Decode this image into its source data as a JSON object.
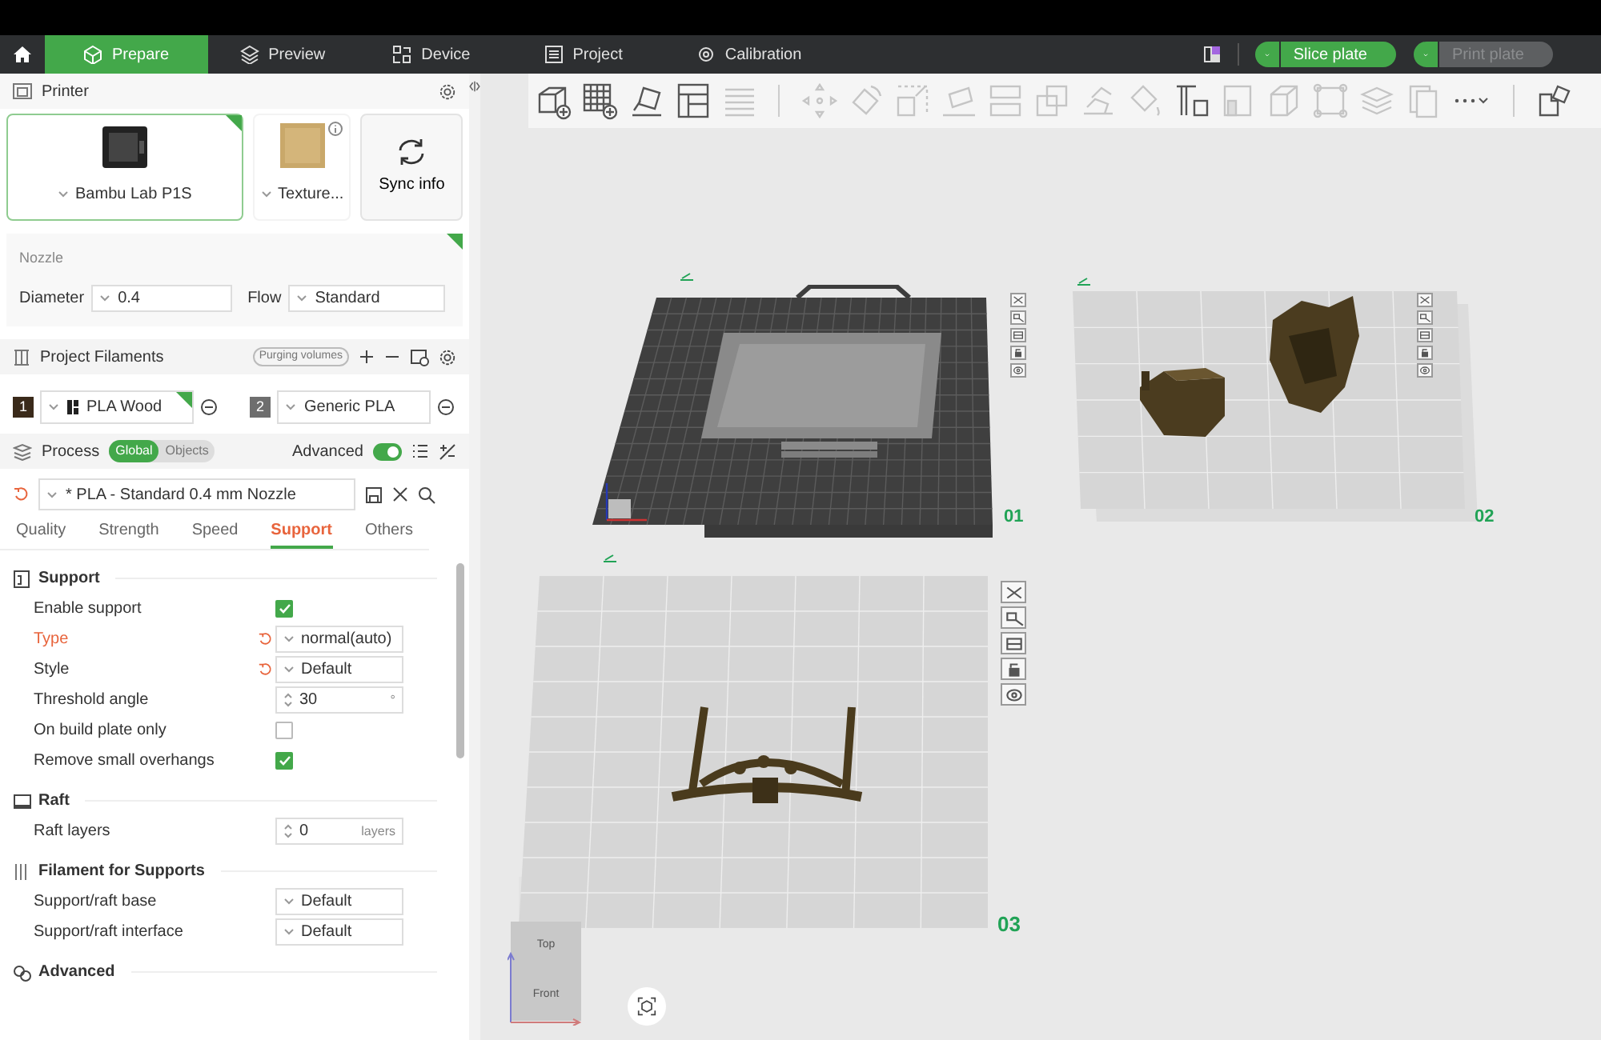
{
  "nav": {
    "tabs": [
      {
        "label": "Prepare",
        "selected": true
      },
      {
        "label": "Preview",
        "selected": false
      },
      {
        "label": "Device",
        "selected": false
      },
      {
        "label": "Project",
        "selected": false
      },
      {
        "label": "Calibration",
        "selected": false
      }
    ],
    "slice_button": {
      "label": "Slice plate",
      "disabled": false
    },
    "print_button": {
      "label": "Print plate",
      "disabled": true
    }
  },
  "printer": {
    "title": "Printer",
    "name": "Bambu Lab P1S",
    "synced": true,
    "plate_type": "Texture...",
    "sync_label": "Sync info",
    "nozzle": {
      "title": "Nozzle",
      "synced": true,
      "diameter_label": "Diameter",
      "diameter": "0.4",
      "flow_label": "Flow",
      "flow": "Standard"
    }
  },
  "filaments": {
    "title": "Project Filaments",
    "purging": "Purging volumes",
    "items": [
      {
        "index": "1",
        "name": "PLA Wood",
        "color": "#3a2a1a",
        "synced": true
      },
      {
        "index": "2",
        "name": "Generic PLA",
        "color": "#6e6e6e",
        "synced": false
      }
    ]
  },
  "process": {
    "title": "Process",
    "modes": [
      {
        "label": "Global",
        "selected": true
      },
      {
        "label": "Objects",
        "selected": false
      }
    ],
    "advanced_label": "Advanced",
    "advanced": true,
    "preset": "* PLA - Standard 0.4 mm Nozzle",
    "tabs": [
      {
        "label": "Quality",
        "selected": false
      },
      {
        "label": "Strength",
        "selected": false
      },
      {
        "label": "Speed",
        "selected": false
      },
      {
        "label": "Support",
        "selected": true
      },
      {
        "label": "Others",
        "selected": false
      }
    ],
    "groups": [
      {
        "title": "Support",
        "rows": [
          {
            "kind": "checkbox",
            "label": "Enable support",
            "checked": true
          },
          {
            "kind": "select",
            "label": "Type",
            "value": "normal(auto)",
            "modified": true,
            "reset": true
          },
          {
            "kind": "select",
            "label": "Style",
            "value": "Default",
            "modified": false,
            "reset": true
          },
          {
            "kind": "spin",
            "label": "Threshold angle",
            "value": "30",
            "unit": "°"
          },
          {
            "kind": "checkbox",
            "label": "On build plate only",
            "checked": false
          },
          {
            "kind": "checkbox",
            "label": "Remove small overhangs",
            "checked": true
          }
        ]
      },
      {
        "title": "Raft",
        "rows": [
          {
            "kind": "spin",
            "label": "Raft layers",
            "value": "0",
            "unit": "layers"
          }
        ]
      },
      {
        "title": "Filament for Supports",
        "rows": [
          {
            "kind": "select",
            "label": "Support/raft base",
            "value": "Default",
            "modified": false
          },
          {
            "kind": "select",
            "label": "Support/raft interface",
            "value": "Default",
            "modified": false
          }
        ]
      },
      {
        "title": "Advanced"
      }
    ]
  },
  "toolbar": {
    "tools": [
      {
        "disabled": false
      },
      {
        "disabled": false
      },
      {
        "disabled": false
      },
      {
        "disabled": false
      },
      {
        "disabled": true
      },
      {
        "disabled": true
      },
      {
        "disabled": true
      },
      {
        "disabled": true
      },
      {
        "disabled": true
      },
      {
        "disabled": true
      },
      {
        "disabled": true
      },
      {
        "disabled": true
      },
      {
        "disabled": true
      },
      {
        "disabled": false
      },
      {
        "disabled": true
      },
      {
        "disabled": true
      },
      {
        "disabled": true
      },
      {
        "disabled": true
      },
      {
        "disabled": true
      },
      {
        "disabled": false
      },
      {
        "disabled": false
      }
    ]
  },
  "plates": [
    {
      "label": "01",
      "kind": "textured"
    },
    {
      "label": "02",
      "kind": "plain"
    },
    {
      "label": "03",
      "kind": "plain"
    }
  ],
  "view_cube": {
    "top": "Top",
    "front": "Front"
  }
}
